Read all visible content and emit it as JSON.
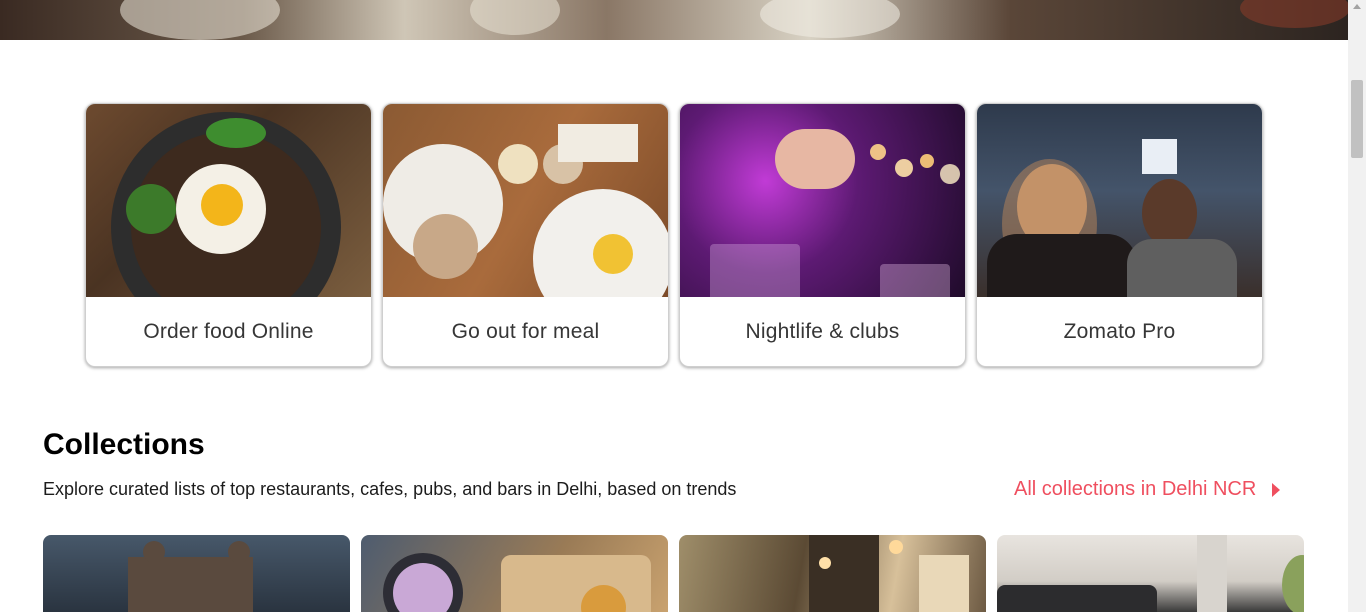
{
  "categories": [
    {
      "label": "Order food Online",
      "image": "bibimbap-bowl-photo"
    },
    {
      "label": "Go out for meal",
      "image": "brunch-table-photo"
    },
    {
      "label": "Nightlife & clubs",
      "image": "cocktail-pour-photo"
    },
    {
      "label": "Zomato Pro",
      "image": "couple-toasting-photo"
    }
  ],
  "collections": {
    "title": "Collections",
    "subtitle": "Explore curated lists of top restaurants, cafes, pubs, and bars in Delhi, based on trends",
    "all_link": "All collections in Delhi NCR",
    "cards": [
      {
        "image": "heritage-building-photo"
      },
      {
        "image": "chaat-platter-photo"
      },
      {
        "image": "cafe-street-photo"
      },
      {
        "image": "laptop-cafe-photo"
      }
    ]
  },
  "colors": {
    "accent": "#ef4f5f",
    "text": "#1c1c1c",
    "label": "#363636"
  },
  "icons": {
    "all_link_arrow": "caret-right-icon"
  }
}
